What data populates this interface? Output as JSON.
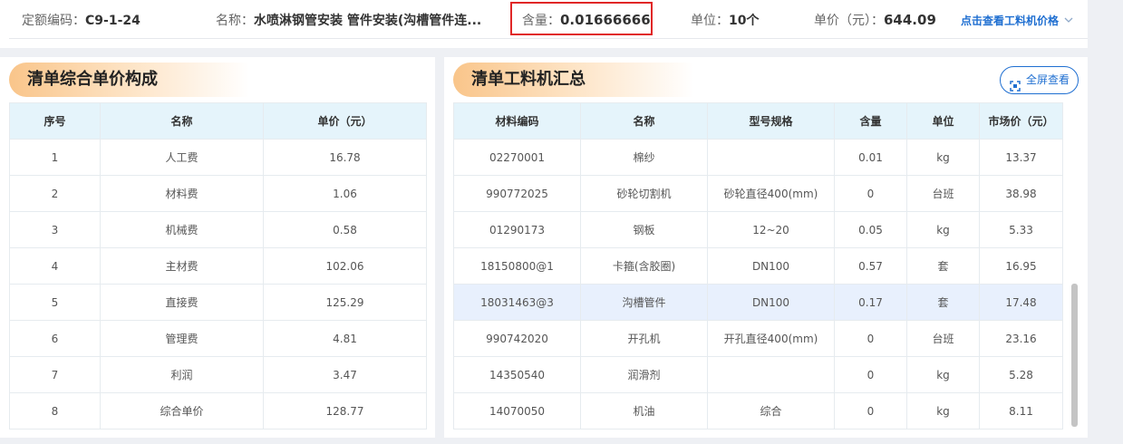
{
  "header": {
    "code_label": "定额编码：",
    "code_value": "C9-1-24",
    "name_label": "名称：",
    "name_value": "水喷淋钢管安装 管件安装(沟槽管件连...",
    "qty_label": "含量：",
    "qty_value": "0.01666666",
    "unit_label": "单位：",
    "unit_value": "10个",
    "price_label": "单价（元）：",
    "price_value": "644.09",
    "view_link": "点击查看工料机价格"
  },
  "composition": {
    "title": "清单综合单价构成",
    "columns": [
      "序号",
      "名称",
      "单价（元）"
    ],
    "rows": [
      [
        "1",
        "人工费",
        "16.78"
      ],
      [
        "2",
        "材料费",
        "1.06"
      ],
      [
        "3",
        "机械费",
        "0.58"
      ],
      [
        "4",
        "主材费",
        "102.06"
      ],
      [
        "5",
        "直接费",
        "125.29"
      ],
      [
        "6",
        "管理费",
        "4.81"
      ],
      [
        "7",
        "利润",
        "3.47"
      ],
      [
        "8",
        "综合单价",
        "128.77"
      ]
    ]
  },
  "materials": {
    "title": "清单工料机汇总",
    "fullscreen_label": "全屏查看",
    "columns": [
      "材料编码",
      "名称",
      "型号规格",
      "含量",
      "单位",
      "市场价（元）"
    ],
    "rows": [
      [
        "02270001",
        "棉纱",
        "",
        "0.01",
        "kg",
        "13.37"
      ],
      [
        "990772025",
        "砂轮切割机",
        "砂轮直径400(mm)",
        "0",
        "台班",
        "38.98"
      ],
      [
        "01290173",
        "钢板",
        "12~20",
        "0.05",
        "kg",
        "5.33"
      ],
      [
        "18150800@1",
        "卡箍(含胶圈)",
        "DN100",
        "0.57",
        "套",
        "16.95"
      ],
      [
        "18031463@3",
        "沟槽管件",
        "DN100",
        "0.17",
        "套",
        "17.48"
      ],
      [
        "990742020",
        "开孔机",
        "开孔直径400(mm)",
        "0",
        "台班",
        "23.16"
      ],
      [
        "14350540",
        "润滑剂",
        "",
        "0",
        "kg",
        "5.28"
      ],
      [
        "14070050",
        "机油",
        "综合",
        "0",
        "kg",
        "8.11"
      ]
    ],
    "selected_row": 5
  },
  "colors": {
    "accent": "#1f6fd1",
    "highlight_border": "#e02727",
    "header_bg": "#e5f4fb",
    "selected_row_bg": "#e8f0fd",
    "title_gradient": "#f9c58a"
  },
  "icons": {
    "fullscreen": "fullscreen-icon",
    "chevron": "chevron-down-icon"
  }
}
